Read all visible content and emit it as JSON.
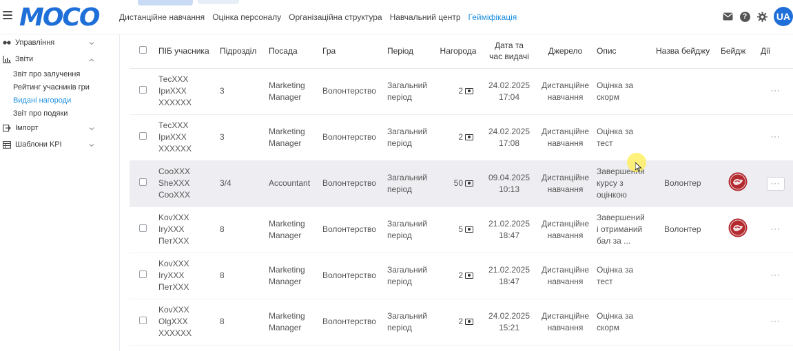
{
  "header": {
    "logo_text": "MOCO",
    "nav": [
      {
        "label": "Дистанційне навчання",
        "active": false
      },
      {
        "label": "Оцінка персоналу",
        "active": false
      },
      {
        "label": "Організаційна структура",
        "active": false
      },
      {
        "label": "Навчальний центр",
        "active": false
      },
      {
        "label": "Гейміфікація",
        "active": true
      }
    ],
    "icons": [
      "mail-icon",
      "help-icon",
      "gear-icon"
    ],
    "help_glyph": "?",
    "avatar_initials": "UA"
  },
  "sidebar": {
    "groups": [
      {
        "label": "Управління",
        "icon": "glasses-icon",
        "expanded": false
      },
      {
        "label": "Звіти",
        "icon": "chart-icon",
        "expanded": true,
        "items": [
          {
            "label": "Звіт про залучення",
            "active": false
          },
          {
            "label": "Рейтинг учасників гри",
            "active": false
          },
          {
            "label": "Видані нагороди",
            "active": true
          },
          {
            "label": "Звіт про подяки",
            "active": false
          }
        ]
      },
      {
        "label": "Імпорт",
        "icon": "import-icon",
        "expanded": false
      },
      {
        "label": "Шаблони KPI",
        "icon": "table-icon",
        "expanded": false
      }
    ]
  },
  "table": {
    "columns": [
      "ПІБ учасника",
      "Підрозділ",
      "Посада",
      "Гра",
      "Період",
      "Нагорода",
      "Дата та час видачі",
      "Джерело",
      "Опис",
      "Назва бейджу",
      "Бейдж",
      "Дії"
    ],
    "column_lines": {
      "date": [
        "Дата та",
        "час видачі"
      ]
    },
    "rows": [
      {
        "name": [
          "ТесXXX",
          "ІриXXX",
          "XXXXXX"
        ],
        "dept": "3",
        "position": [
          "Marketing",
          "Manager"
        ],
        "game": "Волонтерство",
        "period": [
          "Загальний",
          "період"
        ],
        "award": "2",
        "date": [
          "24.02.2025",
          "17:04"
        ],
        "source": [
          "Дистанційне",
          "навчання"
        ],
        "desc": [
          "Оцінка за",
          "скорм"
        ],
        "badge_name": "",
        "has_badge": false,
        "highlight": false
      },
      {
        "name": [
          "ТесXXX",
          "ІриXXX",
          "XXXXXX"
        ],
        "dept": "3",
        "position": [
          "Marketing",
          "Manager"
        ],
        "game": "Волонтерство",
        "period": [
          "Загальний",
          "період"
        ],
        "award": "2",
        "date": [
          "24.02.2025",
          "17:08"
        ],
        "source": [
          "Дистанційне",
          "навчання"
        ],
        "desc": [
          "Оцінка за",
          "тест"
        ],
        "badge_name": "",
        "has_badge": false,
        "highlight": false
      },
      {
        "name": [
          "СооXXX",
          "SheXXX",
          "СооXXX"
        ],
        "dept": "3/4",
        "position": [
          "Accountant"
        ],
        "game": "Волонтерство",
        "period": [
          "Загальний",
          "період"
        ],
        "award": "50",
        "date": [
          "09.04.2025",
          "10:13"
        ],
        "source": [
          "Дистанційне",
          "навчання"
        ],
        "desc": [
          "Завершення",
          "курсу з",
          "оцінкою"
        ],
        "badge_name": "Волонтер",
        "has_badge": true,
        "highlight": true
      },
      {
        "name": [
          "KovXXX",
          "ІryXXX",
          "ПетXXX"
        ],
        "dept": "8",
        "position": [
          "Marketing",
          "Manager"
        ],
        "game": "Волонтерство",
        "period": [
          "Загальний",
          "період"
        ],
        "award": "5",
        "date": [
          "21.02.2025",
          "18:47"
        ],
        "source": [
          "Дистанційне",
          "навчання"
        ],
        "desc": [
          "Завершений",
          "і отриманий",
          "бал за ..."
        ],
        "badge_name": "Волонтер",
        "has_badge": true,
        "highlight": false
      },
      {
        "name": [
          "KovXXX",
          "ІryXXX",
          "ПетXXX"
        ],
        "dept": "8",
        "position": [
          "Marketing",
          "Manager"
        ],
        "game": "Волонтерство",
        "period": [
          "Загальний",
          "період"
        ],
        "award": "2",
        "date": [
          "21.02.2025",
          "18:47"
        ],
        "source": [
          "Дистанційне",
          "навчання"
        ],
        "desc": [
          "Оцінка за",
          "тест"
        ],
        "badge_name": "",
        "has_badge": false,
        "highlight": false
      },
      {
        "name": [
          "KovXXX",
          "OlgXXX",
          "XXXXXX"
        ],
        "dept": "8",
        "position": [
          "Marketing",
          "Manager"
        ],
        "game": "Волонтерство",
        "period": [
          "Загальний",
          "період"
        ],
        "award": "2",
        "date": [
          "24.02.2025",
          "15:21"
        ],
        "source": [
          "Дистанційне",
          "навчання"
        ],
        "desc": [
          "Оцінка за",
          "скорм"
        ],
        "badge_name": "",
        "has_badge": false,
        "highlight": false
      }
    ],
    "actions_glyph": "···"
  },
  "colors": {
    "brand": "#1f6fd8",
    "active_link": "#1f8fe0",
    "row_highlight": "#eeeef2",
    "badge_red": "#b32a2f"
  }
}
